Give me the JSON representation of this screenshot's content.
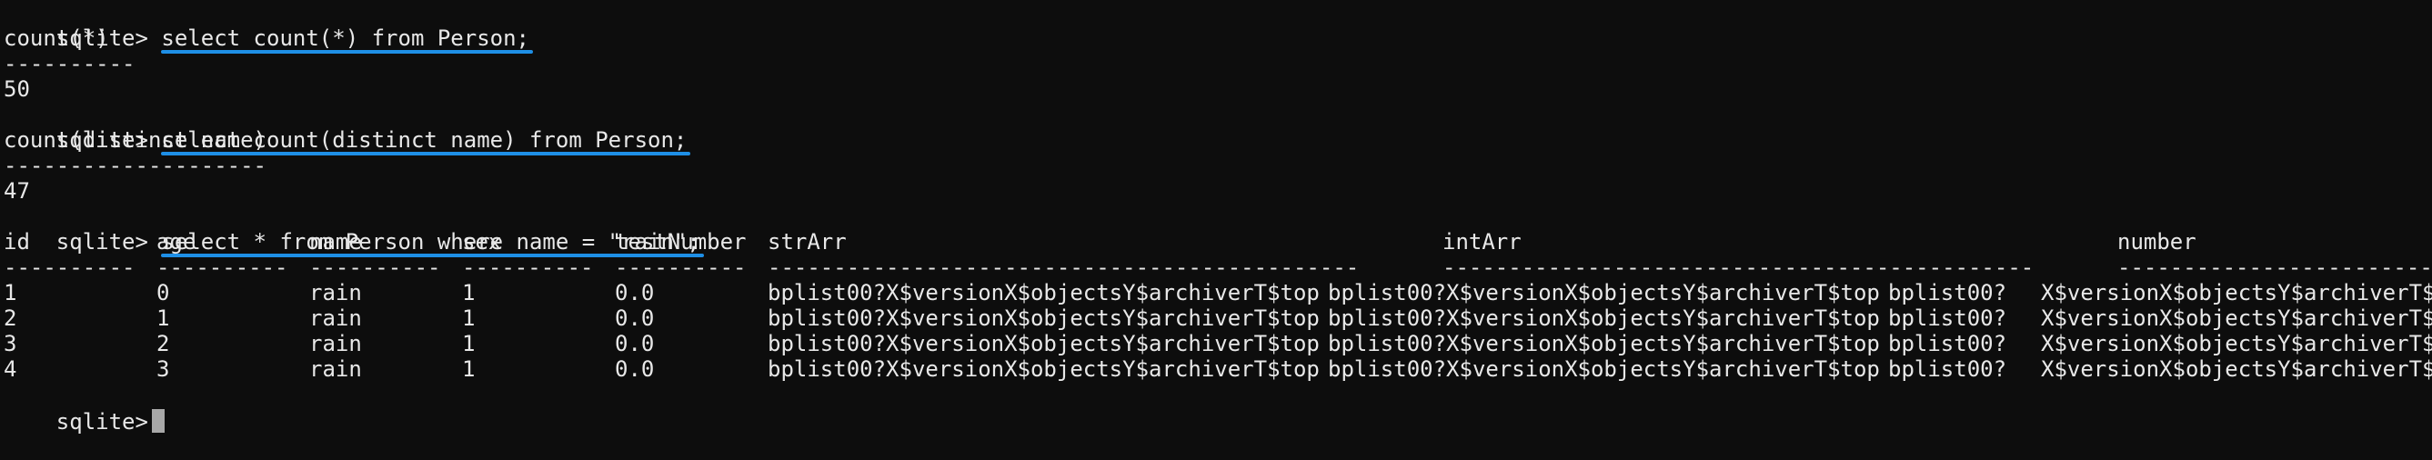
{
  "terminal": {
    "prompt": "sqlite>",
    "blocks": [
      {
        "command": "select count(*) from Person;",
        "header": "count(*)",
        "separator": "----------",
        "result": "50"
      },
      {
        "command": "select count(distinct name) from Person;",
        "header": "count(distinct name)",
        "separator": "--------------------",
        "result": "47"
      }
    ],
    "query3": {
      "command": "select * from Person where name = \"rain\";",
      "columns": [
        "id",
        "age",
        "name",
        "sex",
        "testNumber",
        "strArr",
        "intArr",
        "number"
      ],
      "separators": [
        "----------",
        "----------",
        "----------",
        "----------",
        "----------",
        "---------------------------------------------",
        "---------------------------------------------",
        "-------------------------"
      ],
      "rows": [
        [
          "1",
          "0",
          "rain",
          "1",
          "0.0",
          "bplist00?X$versionX$objectsY$archiverT$top",
          "bplist00?X$versionX$objectsY$archiverT$top",
          "bplist00?",
          "X$versionX$objectsY$archiverT$t"
        ],
        [
          "2",
          "1",
          "rain",
          "1",
          "0.0",
          "bplist00?X$versionX$objectsY$archiverT$top",
          "bplist00?X$versionX$objectsY$archiverT$top",
          "bplist00?",
          "X$versionX$objectsY$archiverT$t"
        ],
        [
          "3",
          "2",
          "rain",
          "1",
          "0.0",
          "bplist00?X$versionX$objectsY$archiverT$top",
          "bplist00?X$versionX$objectsY$archiverT$top",
          "bplist00?",
          "X$versionX$objectsY$archiverT$t"
        ],
        [
          "4",
          "3",
          "rain",
          "1",
          "0.0",
          "bplist00?X$versionX$objectsY$archiverT$top",
          "bplist00?X$versionX$objectsY$archiverT$top",
          "bplist00?",
          "X$versionX$objectsY$archiverT$t"
        ]
      ]
    },
    "colors": {
      "background": "#0d0d0d",
      "text": "#e8e8e8",
      "underline": "#1e8fe6",
      "cursor": "#a8a8a8"
    }
  }
}
